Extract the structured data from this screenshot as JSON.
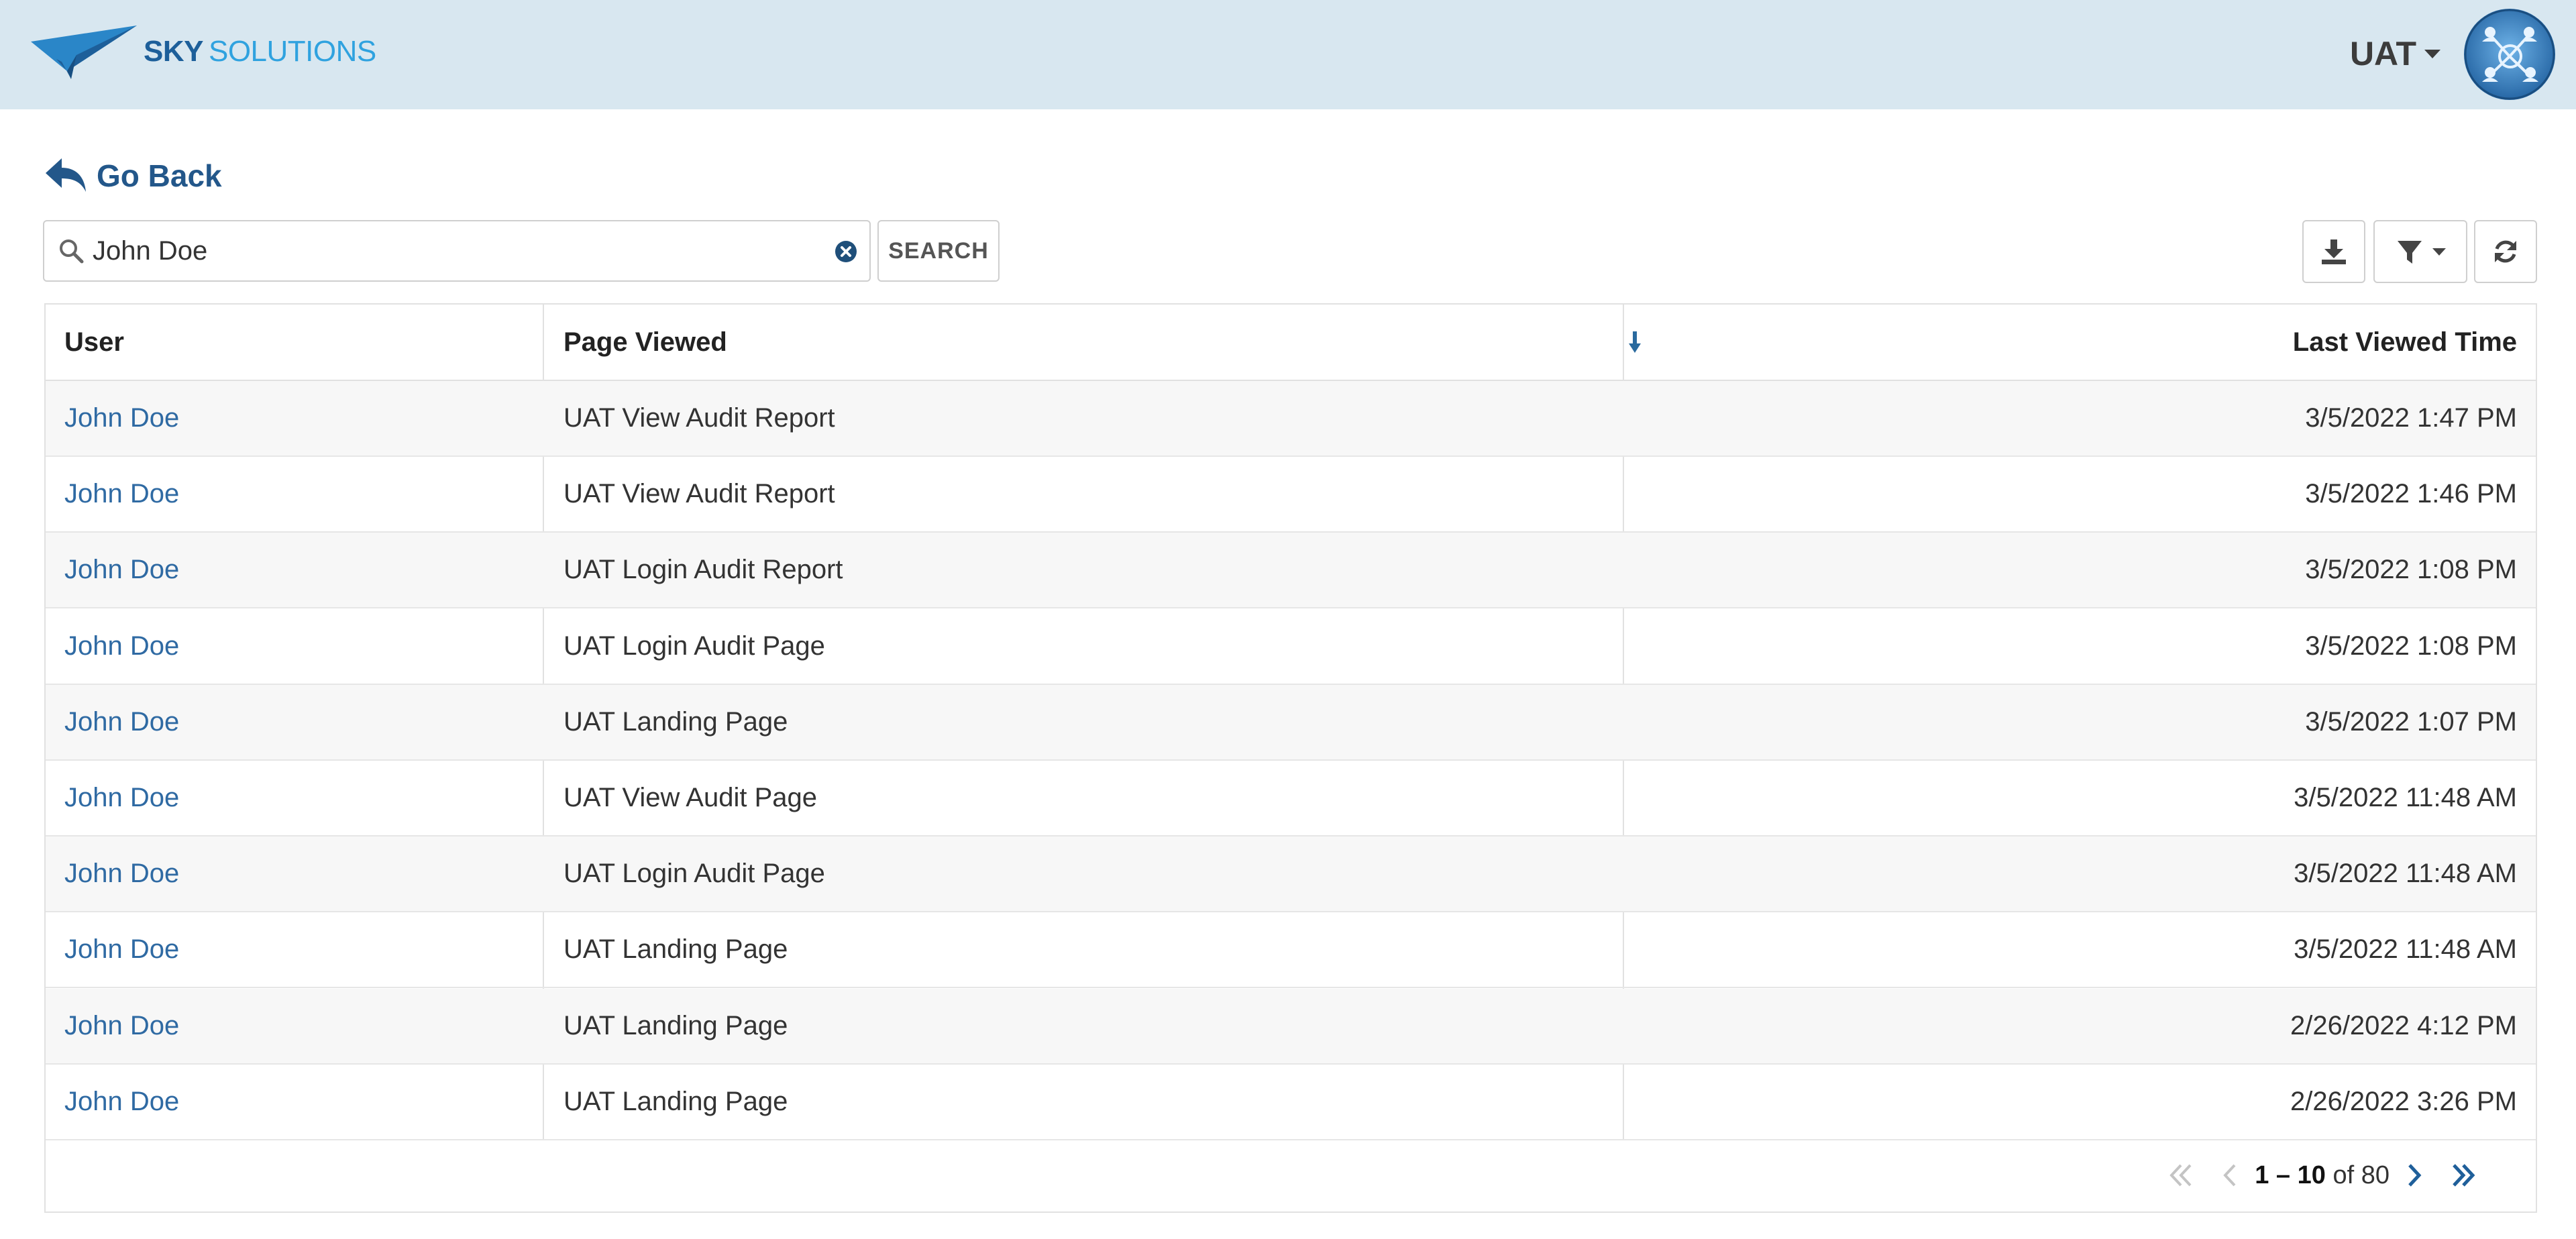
{
  "header": {
    "brand_primary": "SKY",
    "brand_secondary": "SOLUTIONS",
    "environment": "UAT"
  },
  "nav": {
    "go_back_label": "Go Back"
  },
  "search": {
    "value": "John Doe",
    "button_label": "SEARCH"
  },
  "table": {
    "columns": {
      "user": "User",
      "page": "Page Viewed",
      "sort_icon": "arrow-down-icon",
      "time": "Last Viewed Time"
    },
    "rows": [
      {
        "user": "John Doe",
        "page": "UAT View Audit Report",
        "time": "3/5/2022 1:47 PM"
      },
      {
        "user": "John Doe",
        "page": "UAT View Audit Report",
        "time": "3/5/2022 1:46 PM"
      },
      {
        "user": "John Doe",
        "page": "UAT Login Audit Report",
        "time": "3/5/2022 1:08 PM"
      },
      {
        "user": "John Doe",
        "page": "UAT Login Audit Page",
        "time": "3/5/2022 1:08 PM"
      },
      {
        "user": "John Doe",
        "page": "UAT Landing Page",
        "time": "3/5/2022 1:07 PM"
      },
      {
        "user": "John Doe",
        "page": "UAT View Audit Page",
        "time": "3/5/2022 11:48 AM"
      },
      {
        "user": "John Doe",
        "page": "UAT Login Audit Page",
        "time": "3/5/2022 11:48 AM"
      },
      {
        "user": "John Doe",
        "page": "UAT Landing Page",
        "time": "3/5/2022 11:48 AM"
      },
      {
        "user": "John Doe",
        "page": "UAT Landing Page",
        "time": "2/26/2022 4:12 PM"
      },
      {
        "user": "John Doe",
        "page": "UAT Landing Page",
        "time": "2/26/2022 3:26 PM"
      }
    ]
  },
  "pagination": {
    "range": "1 – 10",
    "of_label": "of",
    "total": "80"
  },
  "colors": {
    "header_bg": "#d8e7f0",
    "link": "#2f6aa3",
    "brand_dark": "#1d5f9a",
    "brand_light": "#2fa2df"
  }
}
